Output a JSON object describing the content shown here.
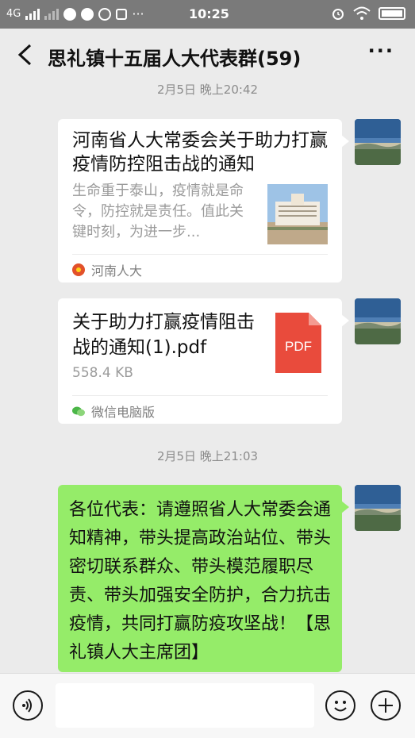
{
  "status_bar": {
    "network": "4G",
    "time": "10:25"
  },
  "header": {
    "title": "思礼镇十五届人大代表群(59)",
    "back_icon": "chevron-left-icon",
    "more_label": "···"
  },
  "messages": [
    {
      "type": "timestamp",
      "text": "2月5日 晚上20:42"
    },
    {
      "type": "link",
      "title": "河南省人大常委会关于助力打赢疫情防控阻击战的通知",
      "description": "生命重于泰山，疫情就是命令，防控就是责任。值此关键时刻，为进一步...",
      "source": "河南人大"
    },
    {
      "type": "file",
      "file_name": "关于助力打赢疫情阻击战的通知(1).pdf",
      "file_size": "558.4 KB",
      "file_type": "PDF",
      "source": "微信电脑版"
    },
    {
      "type": "timestamp",
      "text": "2月5日 晚上21:03"
    },
    {
      "type": "text",
      "text": "各位代表：请遵照省人大常委会通知精神，带头提高政治站位、带头密切联系群众、带头模范履职尽责、带头加强安全防护，合力抗击疫情，共同打赢防疫攻坚战！【思礼镇人大主席团】"
    }
  ],
  "input_bar": {
    "placeholder": ""
  },
  "colors": {
    "background": "#ebebeb",
    "sent_bubble": "#95ec69",
    "pdf_red": "#e94b3c",
    "status_bar": "#7a7a7a"
  }
}
